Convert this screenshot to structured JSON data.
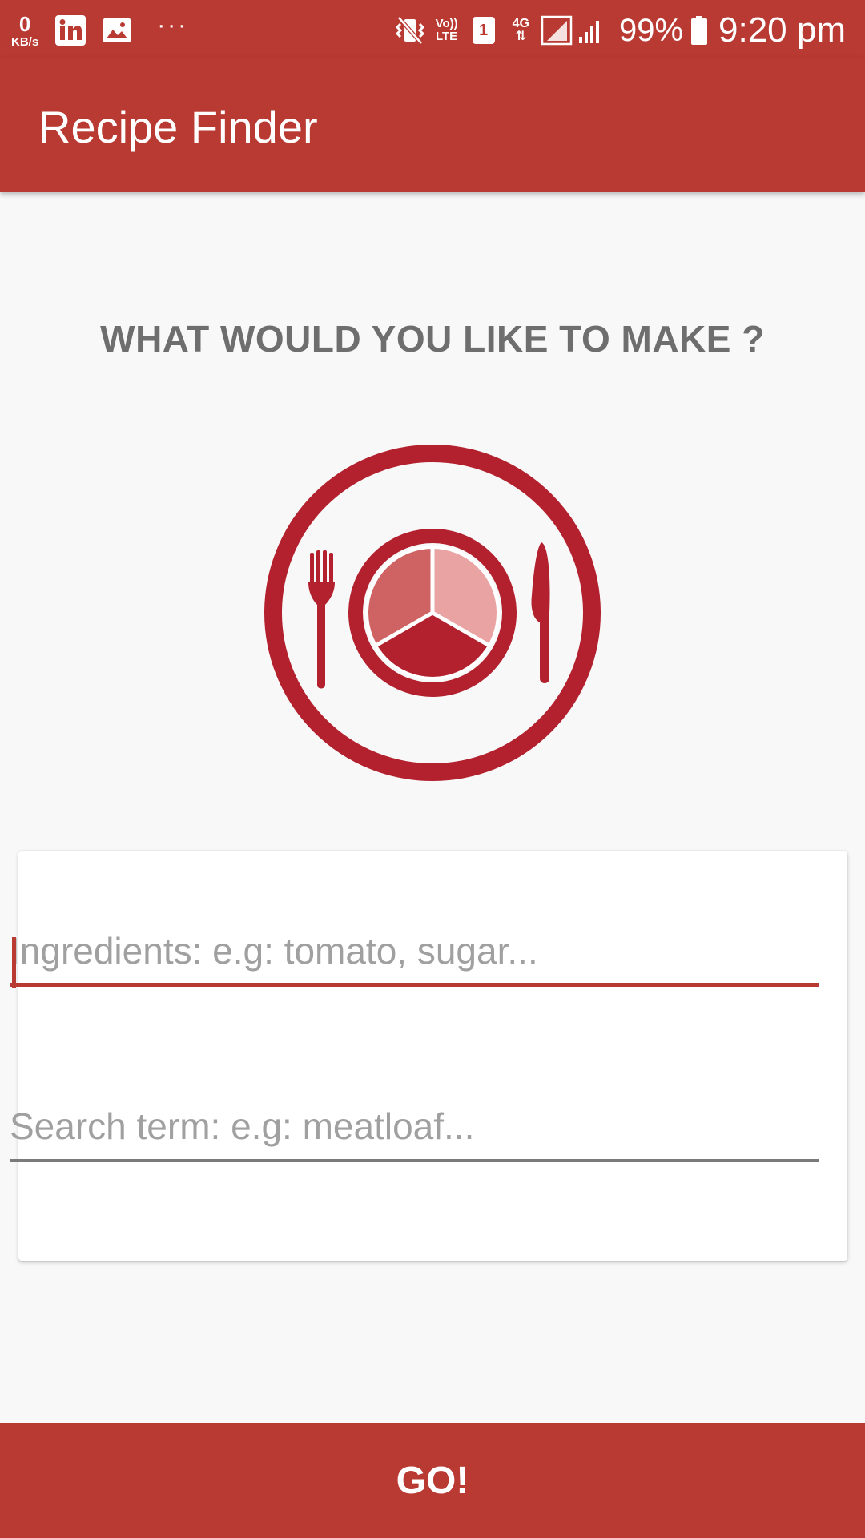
{
  "status_bar": {
    "net_speed_value": "0",
    "net_speed_unit": "KB/s",
    "volte_top": "Vo))",
    "volte_bottom": "LTE",
    "sim_slot": "1",
    "net_type": "4G",
    "battery": "99%",
    "time": "9:20 pm",
    "icons": [
      "linkedin-icon",
      "gallery-icon",
      "more-notifications-icon",
      "vibrate-icon",
      "signal-icon",
      "battery-icon"
    ]
  },
  "app_bar": {
    "title": "Recipe Finder"
  },
  "main": {
    "headline": "WHAT WOULD YOU LIKE TO MAKE ?",
    "logo_icon": "plate-fork-knife-icon",
    "ingredients_placeholder": "Ingredients: e.g: tomato, sugar...",
    "search_placeholder": "Search term: e.g: meatloaf..."
  },
  "actions": {
    "go_label": "GO!"
  },
  "colors": {
    "primary": "#b93a32",
    "logo_red": "#b3212e",
    "pie_mid": "#cf6363",
    "pie_light": "#eaa3a3",
    "headline_gray": "#6e6e6e",
    "background": "#f8f8f8"
  }
}
